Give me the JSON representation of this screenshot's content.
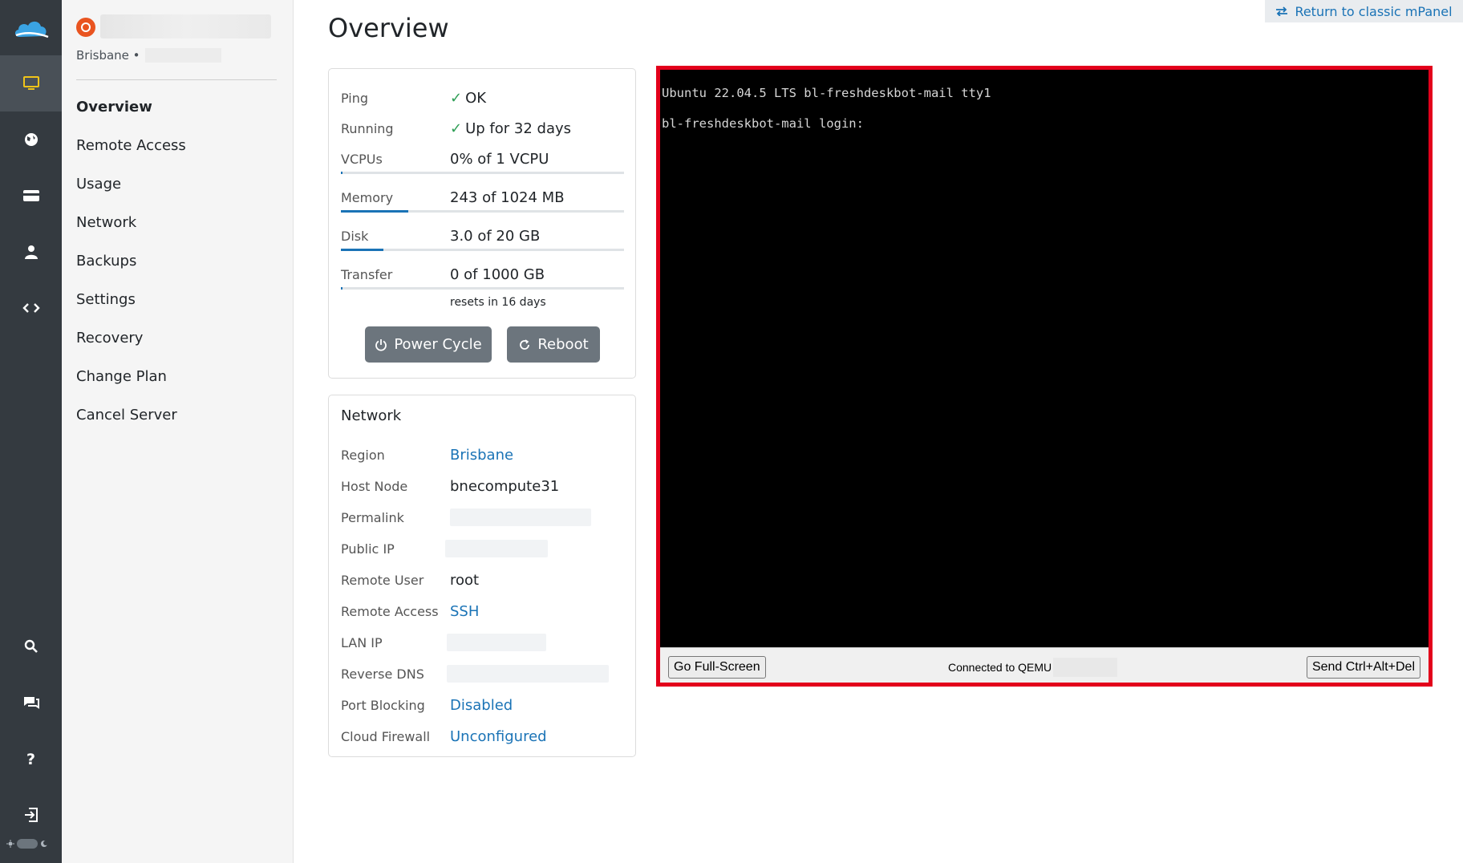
{
  "app": {
    "accent": "#1a73b6",
    "rail_bg": "#343a40",
    "highlight_border": "#e3001b"
  },
  "rail": {
    "logo_icon": "cloud-logo",
    "items": [
      {
        "icon": "monitor-icon",
        "active": true
      },
      {
        "icon": "globe-icon",
        "active": false
      },
      {
        "icon": "credit-card-icon",
        "active": false
      },
      {
        "icon": "user-icon",
        "active": false
      },
      {
        "icon": "code-icon",
        "active": false
      }
    ],
    "bottom_items": [
      {
        "icon": "search-icon"
      },
      {
        "icon": "chat-icon"
      },
      {
        "icon": "help-icon"
      },
      {
        "icon": "logout-icon"
      }
    ],
    "theme_toggle_icons": [
      "sun-icon",
      "moon-icon"
    ]
  },
  "sidebar": {
    "os_icon": "ubuntu-icon",
    "location": "Brisbane •",
    "nav": [
      {
        "label": "Overview",
        "active": true
      },
      {
        "label": "Remote Access"
      },
      {
        "label": "Usage"
      },
      {
        "label": "Network"
      },
      {
        "label": "Backups"
      },
      {
        "label": "Settings"
      },
      {
        "label": "Recovery"
      },
      {
        "label": "Change Plan"
      },
      {
        "label": "Cancel Server"
      }
    ]
  },
  "header": {
    "title": "Overview",
    "classic_link": "Return to classic mPanel"
  },
  "status": {
    "ping": {
      "label": "Ping",
      "value": "OK"
    },
    "running": {
      "label": "Running",
      "value": "Up for 32 days"
    },
    "vcpus": {
      "label": "VCPUs",
      "value": "0% of 1 VCPU",
      "fraction": 0.005
    },
    "memory": {
      "label": "Memory",
      "value": "243 of 1024 MB",
      "fraction": 0.237
    },
    "disk": {
      "label": "Disk",
      "value": "3.0 of 20 GB",
      "fraction": 0.15
    },
    "transfer": {
      "label": "Transfer",
      "value": "0 of 1000 GB",
      "fraction": 0.003
    },
    "resets": "resets in 16 days",
    "power_cycle": "Power Cycle",
    "reboot": "Reboot"
  },
  "network": {
    "title": "Network",
    "region": {
      "label": "Region",
      "value": "Brisbane"
    },
    "host_node": {
      "label": "Host Node",
      "value": "bnecompute31"
    },
    "permalink": {
      "label": "Permalink"
    },
    "public_ip": {
      "label": "Public IP"
    },
    "remote_user": {
      "label": "Remote User",
      "value": "root"
    },
    "remote_access": {
      "label": "Remote Access",
      "value": "SSH"
    },
    "lan_ip": {
      "label": "LAN IP"
    },
    "reverse_dns": {
      "label": "Reverse DNS"
    },
    "port_blocking": {
      "label": "Port Blocking",
      "value": "Disabled"
    },
    "cloud_firewall": {
      "label": "Cloud Firewall",
      "value": "Unconfigured"
    }
  },
  "console": {
    "lines": [
      "Ubuntu 22.04.5 LTS bl-freshdeskbot-mail tty1",
      "bl-freshdeskbot-mail login:"
    ],
    "fullscreen": "Go Full-Screen",
    "connected": "Connected to QEMU",
    "cad": "Send Ctrl+Alt+Del"
  }
}
